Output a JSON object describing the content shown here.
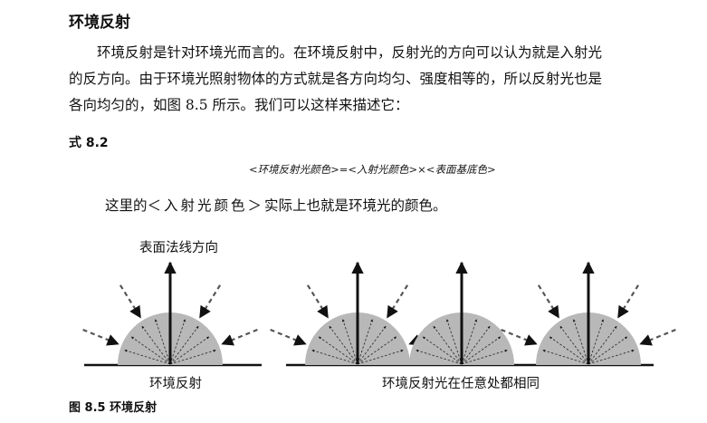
{
  "section_title": "环境反射",
  "paragraph_lines": [
    "　　环境反射是针对环境光而言的。在环境反射中，反射光的方向可以认为就是入射光",
    "的反方向。由于环境光照射物体的方式就是各方向均匀、强度相等的，所以反射光也是",
    "各向均匀的，如图 8.5 所示。我们可以这样来描述它："
  ],
  "equation_label": "式 8.2",
  "formula": "<环境反射光颜色>=<入射光颜色>×<表面基底色>",
  "explain_prefix": "这里的",
  "explain_term": "＜入射光颜色＞",
  "explain_suffix": "实际上也就是环境光的颜色。",
  "figure": {
    "normal_label": "表面法线方向",
    "left_caption": "环境反射",
    "right_caption": "环境反射光在任意处都相同",
    "caption": "图 8.5  环境反射",
    "colors": {
      "dome": "#b8b8b8",
      "arrow": "#111111",
      "incident": "#555555"
    }
  }
}
